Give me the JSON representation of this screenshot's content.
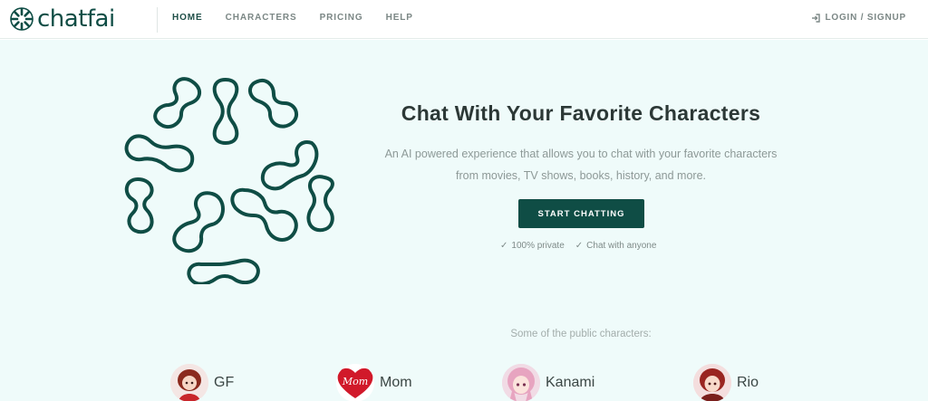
{
  "brand": {
    "name": "chatfai",
    "color": "#0f4d45"
  },
  "nav": {
    "links": [
      {
        "label": "HOME",
        "active": true
      },
      {
        "label": "CHARACTERS",
        "active": false
      },
      {
        "label": "PRICING",
        "active": false
      },
      {
        "label": "HELP",
        "active": false
      }
    ],
    "login": {
      "icon": "login-icon",
      "label": "LOGIN / SIGNUP"
    }
  },
  "hero": {
    "title": "Chat With Your Favorite Characters",
    "subtitle_line1": "An AI powered experience that allows you to chat with your favorite characters",
    "subtitle_line2": "from movies, TV shows, books, history, and more.",
    "cta_label": "START CHATTING",
    "features": [
      {
        "icon": "check-icon",
        "label": "100% private"
      },
      {
        "icon": "check-icon",
        "label": "Chat with anyone"
      }
    ]
  },
  "characters": {
    "heading": "Some of the public characters:",
    "items": [
      {
        "name": "GF"
      },
      {
        "name": "Mom",
        "avatar_text": "Mom"
      },
      {
        "name": "Kanami"
      },
      {
        "name": "Rio"
      }
    ]
  },
  "colors": {
    "accent": "#0f4d45",
    "hero_background": "#effbfa",
    "text_dark": "#2c3836",
    "text_muted": "#8d9997"
  }
}
